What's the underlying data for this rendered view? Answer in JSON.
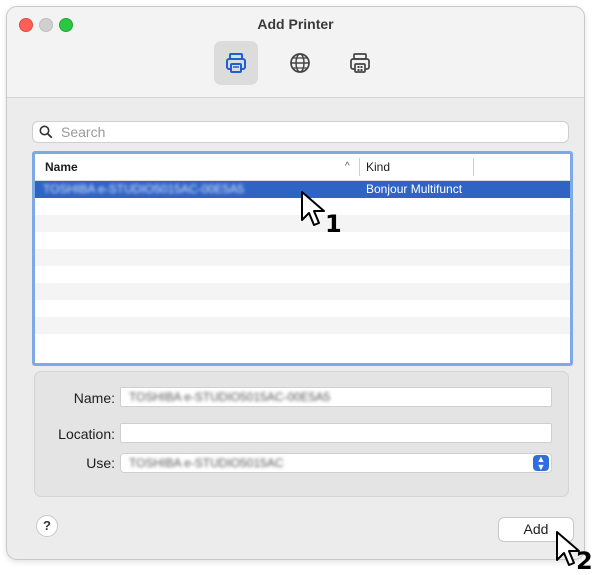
{
  "window": {
    "title": "Add Printer"
  },
  "toolbar": {
    "items": [
      {
        "icon": "printer-icon",
        "active": true
      },
      {
        "icon": "globe-icon",
        "active": false
      },
      {
        "icon": "windows-printer-icon",
        "active": false
      }
    ]
  },
  "search": {
    "placeholder": "Search"
  },
  "list": {
    "columns": {
      "name": "Name",
      "kind": "Kind",
      "sort_indicator": "^"
    },
    "rows": [
      {
        "name": "TOSHIBA e-STUDIO5015AC-00E5A5",
        "kind": "Bonjour Multifunct",
        "selected": true
      }
    ]
  },
  "form": {
    "name_label": "Name:",
    "name_value": "TOSHIBA e-STUDIO5015AC-00E5A5",
    "location_label": "Location:",
    "location_value": "",
    "use_label": "Use:",
    "use_value": "TOSHIBA e-STUDIO5015AC"
  },
  "buttons": {
    "help": "?",
    "add": "Add"
  },
  "callouts": {
    "one": "1",
    "two": "2"
  }
}
